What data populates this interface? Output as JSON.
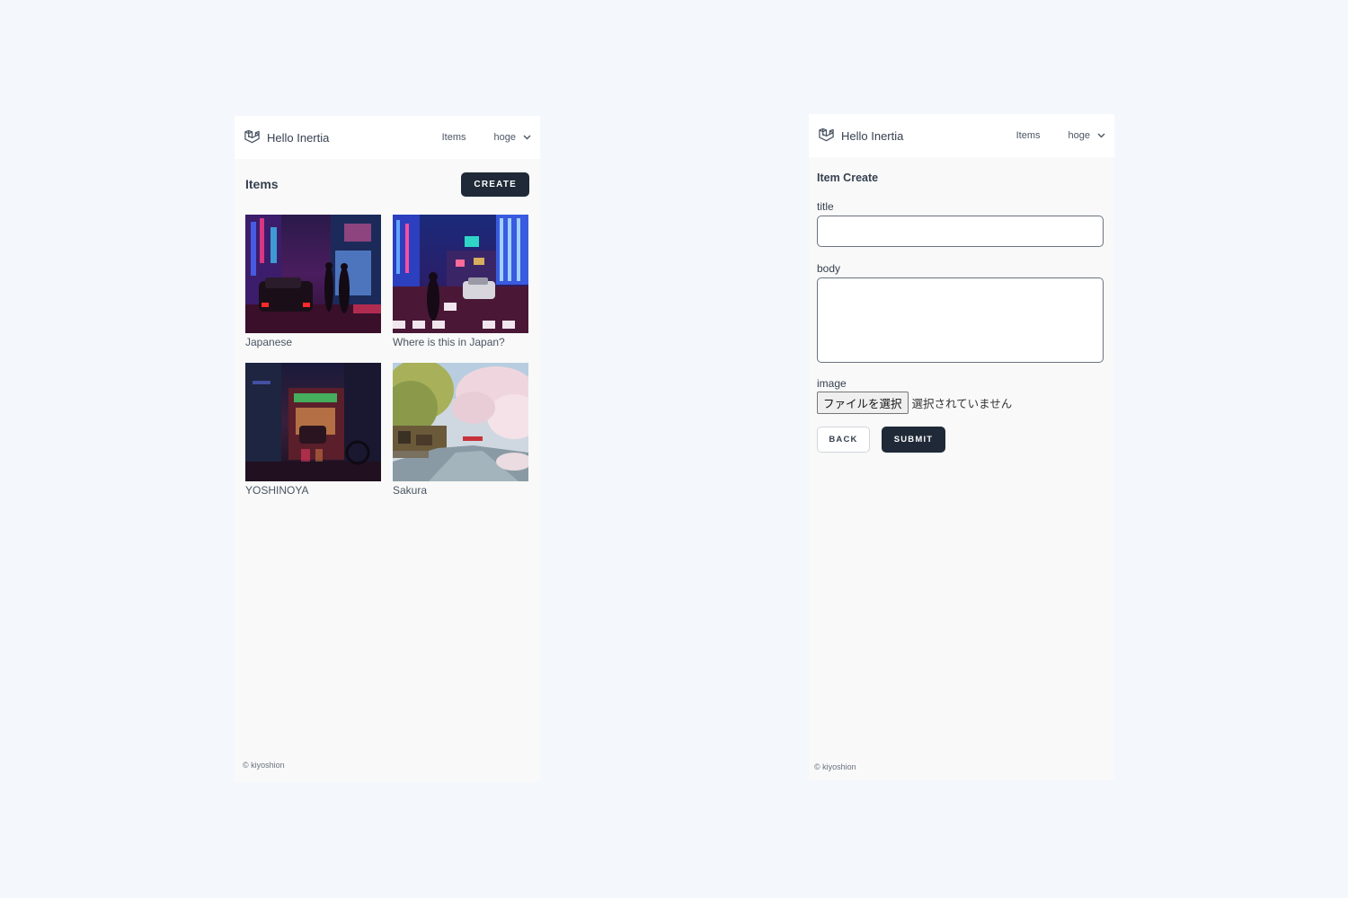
{
  "list_screen": {
    "navbar": {
      "brand": "Hello Inertia",
      "nav_link": "Items",
      "user": "hoge"
    },
    "page_title": "Items",
    "create_label": "CREATE",
    "items": [
      {
        "label": "Japanese"
      },
      {
        "label": "Where is this in Japan?"
      },
      {
        "label": "YOSHINOYA"
      },
      {
        "label": "Sakura"
      }
    ],
    "footer": "© kiyoshion"
  },
  "create_screen": {
    "navbar": {
      "brand": "Hello Inertia",
      "nav_link": "Items",
      "user": "hoge"
    },
    "page_title": "Item Create",
    "fields": {
      "title_label": "title",
      "title_value": "",
      "body_label": "body",
      "body_value": "",
      "image_label": "image",
      "file_button": "ファイルを選択",
      "file_status": "選択されていません"
    },
    "back_label": "BACK",
    "submit_label": "SUBMIT",
    "footer": "© kiyoshion"
  },
  "colors": {
    "page_background": "#f4f7fc",
    "screen_background": "#f8f9f8",
    "button_dark": "#1f2937",
    "text": "#374151"
  }
}
